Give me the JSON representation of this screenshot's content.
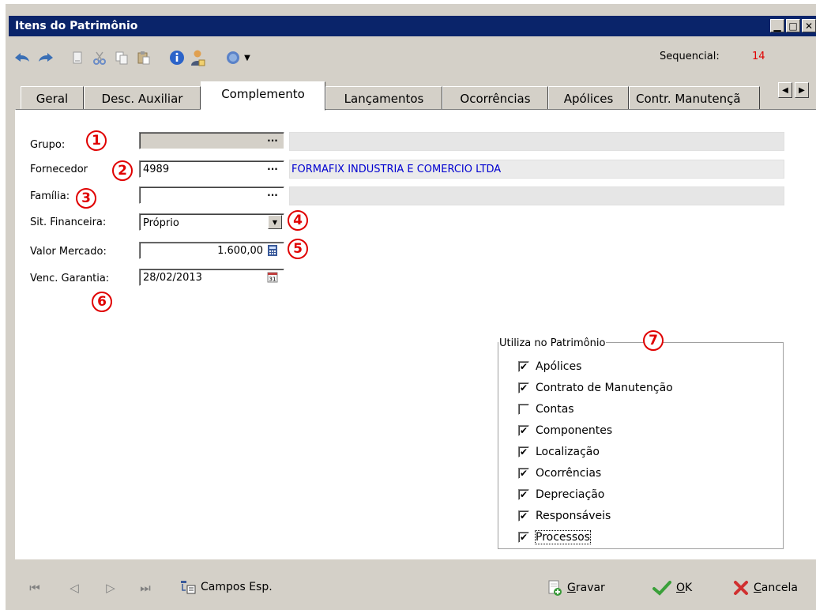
{
  "window": {
    "title": "Itens do Patrimônio"
  },
  "toolbar": {
    "sequencial_label": "Sequencial:",
    "sequencial_value": "14"
  },
  "tabs": [
    {
      "label": "Geral"
    },
    {
      "label": "Desc. Auxiliar"
    },
    {
      "label": "Complemento"
    },
    {
      "label": "Lançamentos"
    },
    {
      "label": "Ocorrências"
    },
    {
      "label": "Apólices"
    },
    {
      "label": "Contr. Manutençã"
    }
  ],
  "form": {
    "grupo": {
      "label": "Grupo:",
      "code": "",
      "description": "",
      "marker": "1"
    },
    "fornecedor": {
      "label": "Fornecedor",
      "code": "4989",
      "description": "FORMAFIX INDUSTRIA E COMERCIO LTDA",
      "marker": "2"
    },
    "familia": {
      "label": "Família:",
      "code": "",
      "description": "",
      "marker": "3"
    },
    "sit_financeira": {
      "label": "Sit. Financeira:",
      "value": "Próprio",
      "marker": "4"
    },
    "valor_mercado": {
      "label": "Valor Mercado:",
      "value": "1.600,00",
      "marker": "5"
    },
    "venc_garantia": {
      "label": "Venc. Garantia:",
      "value": "28/02/2013",
      "marker": "6"
    }
  },
  "utiliza": {
    "title": "Utiliza no Patrimônio",
    "marker": "7",
    "items": [
      {
        "label": "Apólices",
        "checked": true
      },
      {
        "label": "Contrato de Manutenção",
        "checked": true
      },
      {
        "label": "Contas",
        "checked": false
      },
      {
        "label": "Componentes",
        "checked": true
      },
      {
        "label": "Localização",
        "checked": true
      },
      {
        "label": "Ocorrências",
        "checked": true
      },
      {
        "label": "Depreciação",
        "checked": true
      },
      {
        "label": "Responsáveis",
        "checked": true
      },
      {
        "label": "Processos",
        "checked": true
      }
    ]
  },
  "bottom": {
    "campos_esp": "Campos Esp.",
    "gravar_first": "G",
    "gravar_rest": "ravar",
    "ok_first": "O",
    "ok_rest": "K",
    "cancela_first": "C",
    "cancela_rest": "ancela"
  },
  "check_mark": "✔"
}
